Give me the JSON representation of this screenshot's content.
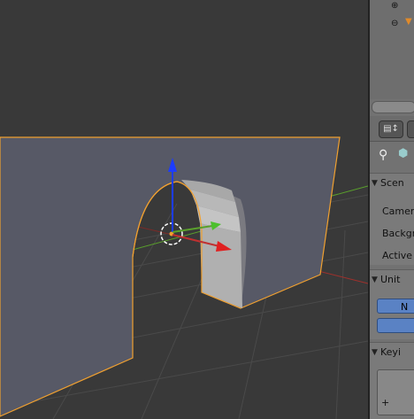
{
  "viewport": {
    "name": "3d-viewport",
    "colors": {
      "background": "#393939",
      "mesh_face": "#575966",
      "outline": "#f0a030",
      "x_axis": "#a0302c",
      "y_axis": "#5aa02c",
      "z_axis": "#1c3cff"
    }
  },
  "outliner": {
    "icons": [
      "restrict-icon",
      "object-icon",
      "collapse-icon"
    ]
  },
  "properties": {
    "header_icons": [
      "editor-type-icon",
      "properties-context-icon"
    ],
    "tool_icons": [
      "pin-icon",
      "scene-icon"
    ],
    "scene_panel": {
      "title": "Scen",
      "rows": [
        "Camer",
        "Backgr",
        "Active"
      ]
    },
    "units_panel": {
      "title": "Unit",
      "button_label": "N"
    },
    "keying_panel": {
      "title": "Keyi",
      "add_symbol": "+"
    }
  }
}
